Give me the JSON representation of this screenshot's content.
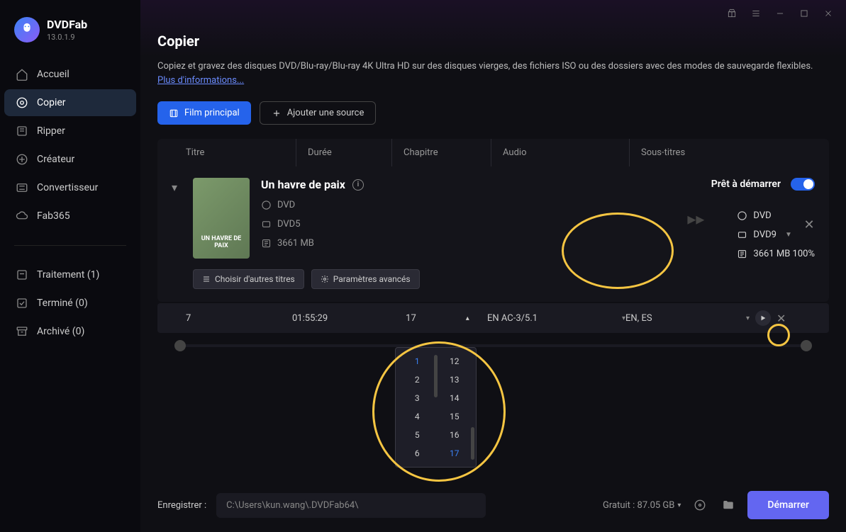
{
  "app": {
    "name": "DVDFab",
    "version": "13.0.1.9"
  },
  "sidebar": {
    "items": [
      {
        "label": "Accueil",
        "icon": "home"
      },
      {
        "label": "Copier",
        "icon": "disc",
        "active": true
      },
      {
        "label": "Ripper",
        "icon": "ripper"
      },
      {
        "label": "Créateur",
        "icon": "creator"
      },
      {
        "label": "Convertisseur",
        "icon": "converter"
      },
      {
        "label": "Fab365",
        "icon": "cloud"
      }
    ],
    "queue": [
      {
        "label": "Traitement (1)"
      },
      {
        "label": "Terminé (0)"
      },
      {
        "label": "Archivé (0)"
      }
    ]
  },
  "page": {
    "title": "Copier",
    "desc": "Copiez et gravez des disques DVD/Blu-ray/Blu-ray 4K Ultra HD sur des disques vierges, des fichiers ISO ou des dossiers avec des modes de sauvegarde flexibles. ",
    "more": "Plus d'informations..."
  },
  "actions": {
    "mode": "Film principal",
    "add": "Ajouter une source"
  },
  "table": {
    "headers": {
      "titre": "Titre",
      "duree": "Durée",
      "chapitre": "Chapitre",
      "audio": "Audio",
      "sous": "Sous-titres"
    }
  },
  "source": {
    "movie_title": "Un havre de paix",
    "poster_label": "UN HAVRE DE PAIX",
    "input": {
      "type": "DVD",
      "disc": "DVD5",
      "size": "3661 MB"
    },
    "output": {
      "type": "DVD",
      "disc": "DVD9",
      "size": "3661 MB 100%"
    },
    "status": "Prêt à démarrer",
    "other_titles": "Choisir d'autres titres",
    "adv": "Paramètres avancés"
  },
  "row": {
    "titre": "7",
    "duree": "01:55:29",
    "chapitre": "17",
    "audio": "EN  AC-3/5.1",
    "sous": "EN, ES"
  },
  "chapter_dd": {
    "col1": [
      "1",
      "2",
      "3",
      "4",
      "5",
      "6"
    ],
    "col2": [
      "12",
      "13",
      "14",
      "15",
      "16",
      "17"
    ]
  },
  "bottom": {
    "save_label": "Enregistrer :",
    "path": "C:\\Users\\kun.wang\\.DVDFab64\\",
    "free": "Gratuit : 87.05 GB",
    "start": "Démarrer"
  }
}
